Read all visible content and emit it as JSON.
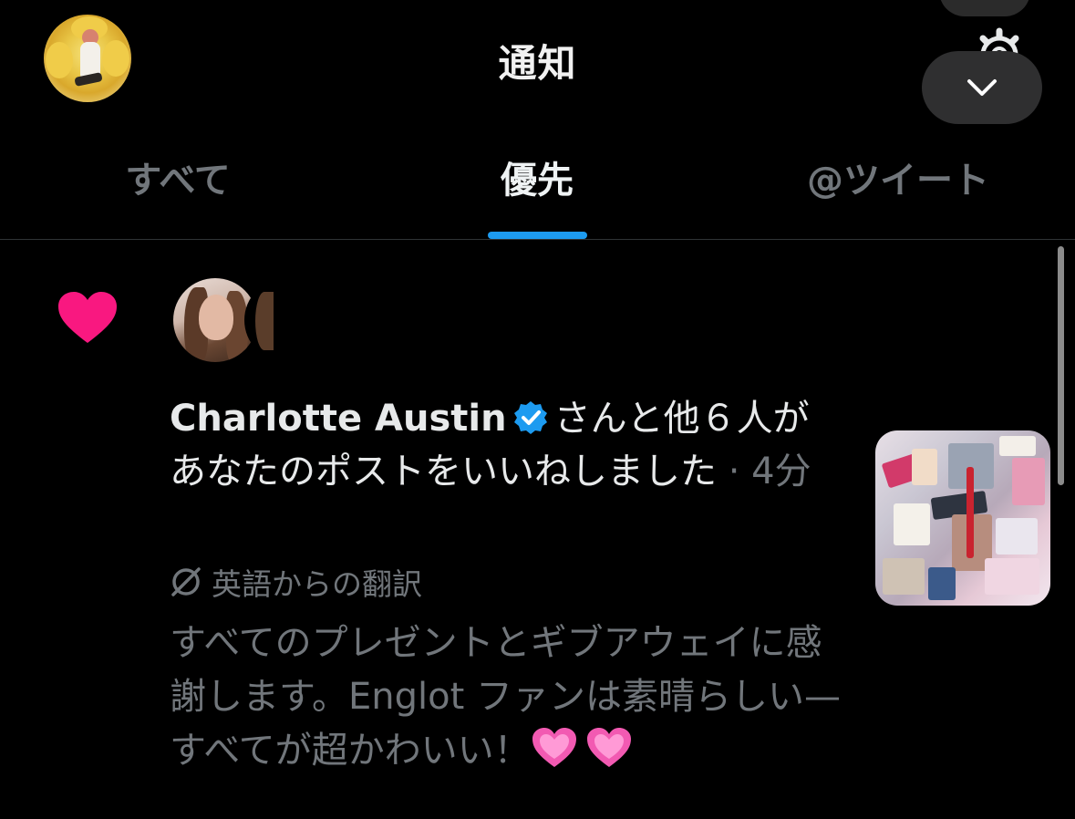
{
  "header": {
    "title": "通知"
  },
  "tabs": [
    {
      "label": "すべて"
    },
    {
      "label": "優先"
    },
    {
      "label": "@ツイート"
    }
  ],
  "notification": {
    "actor_name": "Charlotte Austin",
    "action_line1": "さんと他６人が",
    "action_line2": "あなたのポストをいいねしました",
    "separator": " · ",
    "time": "4分",
    "translation_label": "英語からの翻訳",
    "post_text": "すべてのプレゼントとギブアウェイに感謝します。Englot ファンは素晴らしい—すべてが超かわいい！",
    "icons": {
      "type": "heart-icon",
      "verified": "verified-badge-icon",
      "translate": "translate-icon"
    },
    "colors": {
      "heart": "#f91880",
      "verified": "#1d9bf0",
      "tab_indicator": "#1d9bf0"
    }
  }
}
